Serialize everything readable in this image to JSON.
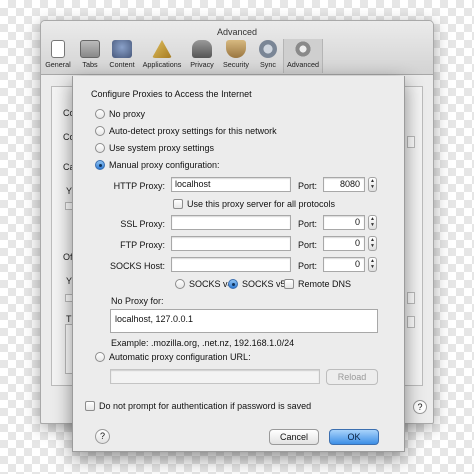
{
  "window": {
    "title": "Advanced",
    "toolbar": [
      {
        "label": "General",
        "icon": "general-icon"
      },
      {
        "label": "Tabs",
        "icon": "tabs-icon"
      },
      {
        "label": "Content",
        "icon": "content-icon"
      },
      {
        "label": "Applications",
        "icon": "applications-icon"
      },
      {
        "label": "Privacy",
        "icon": "privacy-icon"
      },
      {
        "label": "Security",
        "icon": "security-icon"
      },
      {
        "label": "Sync",
        "icon": "sync-icon"
      },
      {
        "label": "Advanced",
        "icon": "advanced-icon"
      }
    ],
    "background_fragments": [
      "Co",
      "Co",
      "Ca",
      "Y",
      "Of",
      "Y",
      "T"
    ]
  },
  "dialog": {
    "title": "Configure Proxies to Access the Internet",
    "options": {
      "no_proxy": "No proxy",
      "auto_detect": "Auto-detect proxy settings for this network",
      "system": "Use system proxy settings",
      "manual": "Manual proxy configuration:",
      "auto_config": "Automatic proxy configuration URL:"
    },
    "selected": "manual",
    "http": {
      "label": "HTTP Proxy:",
      "value": "localhost",
      "port_label": "Port:",
      "port": "8080"
    },
    "use_for_all": "Use this proxy server for all protocols",
    "ssl": {
      "label": "SSL Proxy:",
      "value": "",
      "port_label": "Port:",
      "port": "0"
    },
    "ftp": {
      "label": "FTP Proxy:",
      "value": "",
      "port_label": "Port:",
      "port": "0"
    },
    "socks": {
      "label": "SOCKS Host:",
      "value": "",
      "port_label": "Port:",
      "port": "0"
    },
    "socks_v4": "SOCKS v4",
    "socks_v5": "SOCKS v5",
    "socks_selected": "v5",
    "remote_dns": "Remote DNS",
    "no_proxy_label": "No Proxy for:",
    "no_proxy_value": "localhost, 127.0.0.1",
    "example": "Example: .mozilla.org, .net.nz, 192.168.1.0/24",
    "auto_url_value": "",
    "reload_label": "Reload",
    "no_prompt": "Do not prompt for authentication if password is saved",
    "help": "?",
    "cancel": "Cancel",
    "ok": "OK"
  },
  "colors": {
    "accent": "#3d8fe6",
    "window_bg": "#ececec"
  }
}
